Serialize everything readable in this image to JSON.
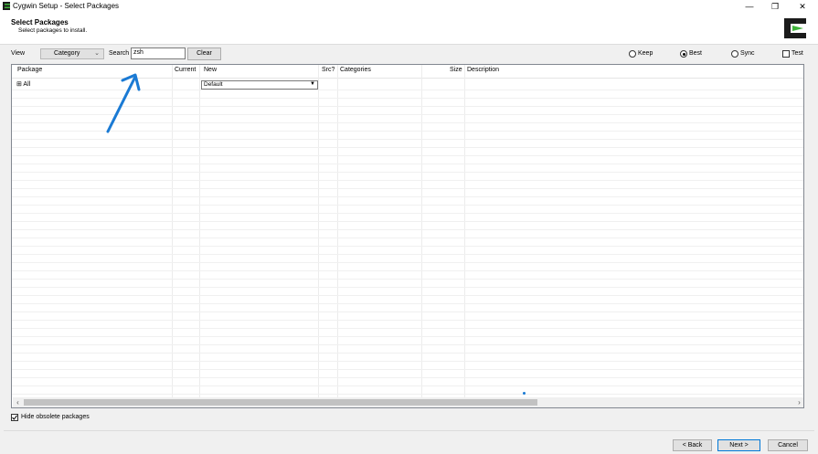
{
  "window": {
    "title": "Cygwin Setup - Select Packages",
    "minimize_glyph": "—",
    "restore_glyph": "❐",
    "close_glyph": "✕"
  },
  "header": {
    "title": "Select Packages",
    "subtitle": "Select packages to install."
  },
  "toolbar": {
    "view_label": "View",
    "view_value": "Category",
    "search_label": "Search",
    "search_value": "zsh",
    "clear_label": "Clear",
    "radios": [
      {
        "label": "Keep",
        "checked": false
      },
      {
        "label": "Best",
        "checked": true
      },
      {
        "label": "Sync",
        "checked": false
      }
    ],
    "test_label": "Test",
    "test_checked": false
  },
  "table": {
    "columns": [
      "Package",
      "Current",
      "New",
      "Src?",
      "Categories",
      "Size",
      "Description"
    ],
    "rows": [
      {
        "package": "⊞ All",
        "current": "",
        "new": "Default",
        "src": "",
        "categories": "",
        "size": "",
        "description": ""
      }
    ]
  },
  "hide_obsolete": {
    "label": "Hide obsolete packages",
    "checked": true
  },
  "footer": {
    "back_label": "< Back",
    "next_label": "Next >",
    "cancel_label": "Cancel"
  },
  "colors": {
    "accent": "#0078d7",
    "logo_green": "#3fb43a",
    "annotation_arrow": "#1a7ad4"
  },
  "icons": [
    "cygwin-app-icon",
    "cygwin-logo",
    "chevron-down-icon",
    "scroll-left-icon",
    "scroll-right-icon",
    "annotation-arrow"
  ]
}
